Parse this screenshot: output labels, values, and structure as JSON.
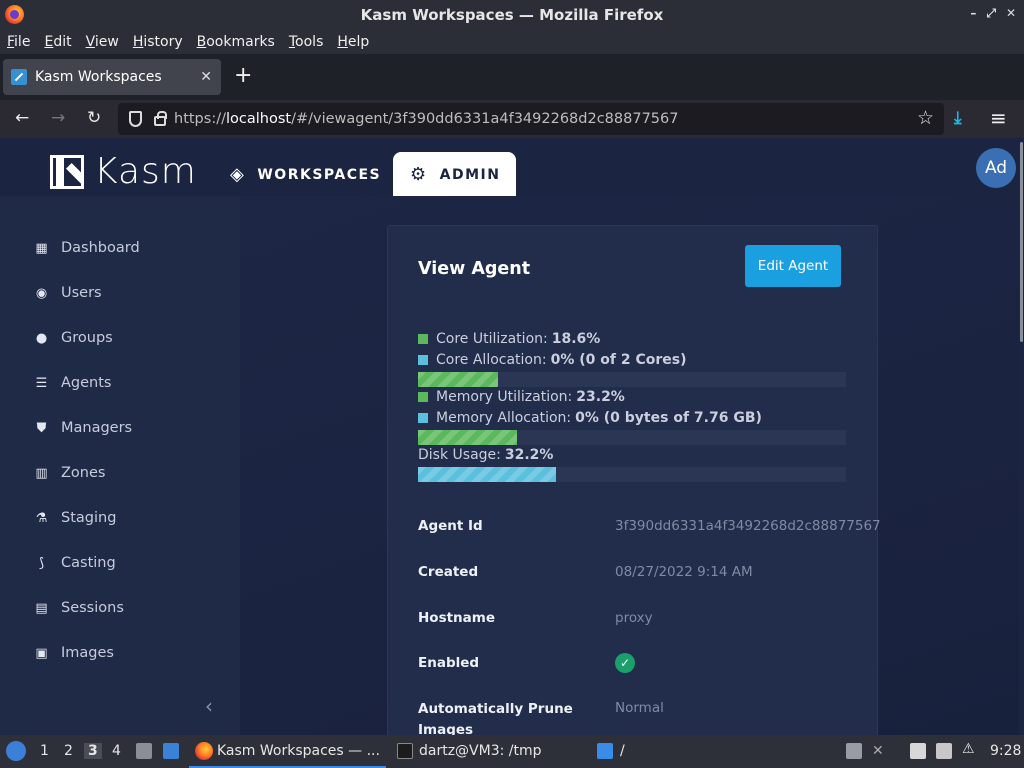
{
  "window": {
    "title": "Kasm Workspaces — Mozilla Firefox"
  },
  "menu": [
    "File",
    "Edit",
    "View",
    "History",
    "Bookmarks",
    "Tools",
    "Help"
  ],
  "tab": {
    "title": "Kasm Workspaces"
  },
  "url": {
    "prefix": "https://",
    "host": "localhost",
    "path": "/#/viewagent/3f390dd6331a4f3492268d2c88877567"
  },
  "kasm": {
    "logo": "Kasm",
    "nav_workspaces": "WORKSPACES",
    "nav_admin": "ADMIN",
    "avatar": "Ad",
    "sidebar": [
      "Dashboard",
      "Users",
      "Groups",
      "Agents",
      "Managers",
      "Zones",
      "Staging",
      "Casting",
      "Sessions",
      "Images"
    ]
  },
  "card": {
    "title": "View Agent",
    "edit_button": "Edit Agent",
    "core_util_label": "Core Utilization:",
    "core_util_value": "18.6%",
    "core_alloc_label": "Core Allocation:",
    "core_alloc_value": "0% (0 of 2 Cores)",
    "mem_util_label": "Memory Utilization:",
    "mem_util_value": "23.2%",
    "mem_alloc_label": "Memory Allocation:",
    "mem_alloc_value": "0% (0 bytes of 7.76 GB)",
    "disk_label": "Disk Usage:",
    "disk_value": "32.2%",
    "bars": {
      "core_util": 18.6,
      "mem_util": 23.2,
      "disk": 32.2
    },
    "colors": {
      "green": "#5cb85c",
      "blue": "#5bc0de"
    },
    "rows": [
      {
        "label": "Agent Id",
        "value": "3f390dd6331a4f3492268d2c88877567"
      },
      {
        "label": "Created",
        "value": "08/27/2022 9:14 AM"
      },
      {
        "label": "Hostname",
        "value": "proxy"
      },
      {
        "label": "Enabled",
        "value": ""
      },
      {
        "label": "Automatically Prune",
        "label2": "Images",
        "value": "Normal"
      }
    ]
  },
  "taskbar": {
    "workspaces": [
      "1",
      "2",
      "3",
      "4"
    ],
    "firefox_task": "Kasm Workspaces — ...",
    "terminal_task": "dartz@VM3: /tmp",
    "files_task": "/",
    "clock": "9:28"
  }
}
